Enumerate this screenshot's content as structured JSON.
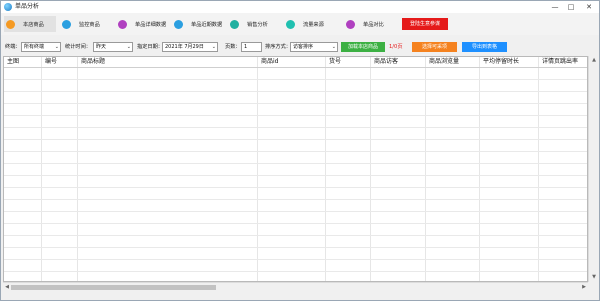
{
  "window": {
    "title": "单品分析",
    "minimize_icon": "minimize-icon",
    "maximize_icon": "maximize-icon",
    "close_icon": "close-icon"
  },
  "tabs": [
    {
      "label": "本店商品",
      "icon": "store-icon",
      "color": "#f59a23"
    },
    {
      "label": "监控商品",
      "icon": "monitor-icon",
      "color": "#2b9fe0"
    },
    {
      "label": "单品详细数据",
      "icon": "detail-icon",
      "color": "#b040c0"
    },
    {
      "label": "单品近期数据",
      "icon": "recent-icon",
      "color": "#2b9fe0"
    },
    {
      "label": "销售分析",
      "icon": "sales-icon",
      "color": "#20b0a0"
    },
    {
      "label": "流量来源",
      "icon": "traffic-icon",
      "color": "#20c0b0"
    },
    {
      "label": "单品对比",
      "icon": "compare-icon",
      "color": "#b040c0"
    }
  ],
  "login_button": "登陆生意参谋",
  "filters": {
    "terminal_label": "终端：",
    "terminal_value": "所有终端",
    "period_label": "统计时间：",
    "period_value": "昨天",
    "date_label": "指定日期：",
    "date_value": "2021年 7月29日",
    "pages_label": "页数：",
    "pages_value": "1",
    "sort_label": "排序方式：",
    "sort_value": "访客排序",
    "load_button": "加载本店商品",
    "page_count": "1/0页",
    "select_button": "选择可采项",
    "export_button": "导出到表格"
  },
  "colors": {
    "login": "#e51a1a",
    "load": "#3cb043",
    "select": "#f5821f",
    "export": "#1e90ff"
  },
  "table": {
    "columns": [
      "主图",
      "编号",
      "商品标题",
      "商品id",
      "货号",
      "商品访客",
      "商品浏览量",
      "平均停留时长",
      "详情页跳出率"
    ]
  }
}
